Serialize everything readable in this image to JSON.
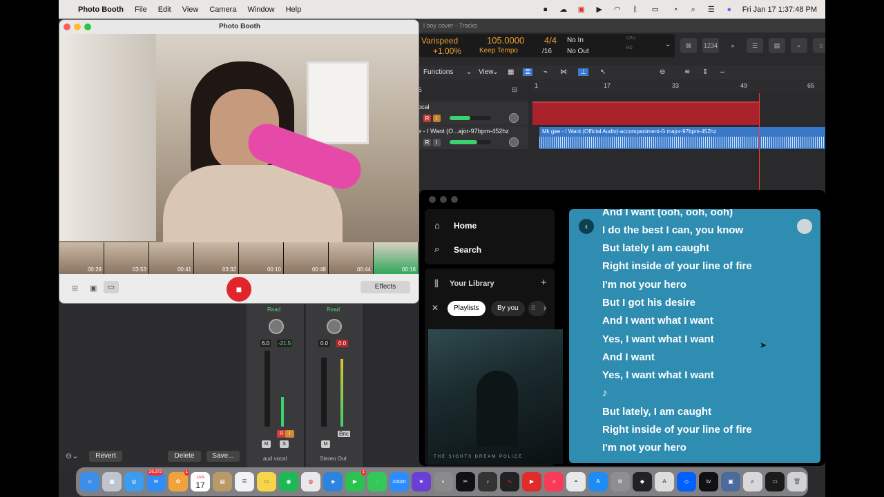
{
  "menubar": {
    "app_name": "Photo Booth",
    "items": [
      "File",
      "Edit",
      "View",
      "Camera",
      "Window",
      "Help"
    ],
    "clock": "Fri Jan 17  1:37:48 PM"
  },
  "logic": {
    "window_title": "l boy cover - Tracks",
    "lcd": {
      "varispeed_label": "Varispeed",
      "varispeed_value": "+1.00%",
      "tempo": "105.0000",
      "tempo_mode": "Keep Tempo",
      "signature_top": "4/4",
      "signature_bottom": "/16",
      "in_label": "No In",
      "out_label": "No Out",
      "cpu_label": "CPU",
      "hd_label": "HD"
    },
    "counter": "1234",
    "menu": {
      "functions": "Functions",
      "view": "View"
    },
    "ruler": [
      "1",
      "17",
      "33",
      "49",
      "65"
    ],
    "tracks": [
      {
        "name": "ocal",
        "r": "R",
        "i": "I"
      },
      {
        "name": "e - I Want (O...ajor-97bpm-452hz",
        "r": "R",
        "i": "I"
      }
    ],
    "region_label": "Mk gee - I Want (Official Audio)-accompaniment-G major-97bpm-452hz",
    "side_label": "S"
  },
  "mixer": {
    "strips": [
      {
        "automation": "Read",
        "values": [
          "6.0",
          "-21.5"
        ],
        "name": "aud vocal",
        "m": "M",
        "s": "S",
        "r": "R",
        "i": "I"
      },
      {
        "automation": "Read",
        "values": [
          "0.0",
          "0.0"
        ],
        "name": "Stereo Out",
        "m": "M",
        "bnc": "Bnc"
      }
    ]
  },
  "photobooth": {
    "title": "Photo Booth",
    "thumbnails": [
      "00:29",
      "03:53",
      "00:41",
      "03:32",
      "00:10",
      "00:48",
      "00:44",
      "00:16"
    ],
    "effects": "Effects",
    "revert": "Revert",
    "delete": "Delete",
    "save": "Save..."
  },
  "spotify": {
    "nav": {
      "home": "Home",
      "search": "Search"
    },
    "library": "Your Library",
    "filters": [
      "Playlists",
      "By you",
      "B"
    ],
    "album_text": "THE SIGHTS   DREAM POLICE",
    "lyrics": [
      "And I want (ooh, ooh, ooh)",
      "I do the best I can, you know",
      "But lately I am caught",
      "Right inside of your line of fire",
      "I'm not your hero",
      "But I got his desire",
      "And I want what I want",
      "Yes, I want what I want",
      "And I want",
      "Yes, I want what I want",
      "♪",
      "But lately, I am caught",
      "Right inside of your line of fire",
      "I'm not your hero"
    ]
  },
  "dock": {
    "badges": {
      "mail": "26,372",
      "photos_badge": "1",
      "facetime_badge": "1"
    },
    "calendar": {
      "month": "JAN",
      "day": "17"
    },
    "apps": [
      "finder-icon",
      "launchpad-icon",
      "safari-icon",
      "mail-icon",
      "photos-icon",
      "calendar-icon",
      "notes-icon",
      "reminders-icon",
      "spotify-icon",
      "chrome-icon",
      "safari2-icon",
      "facetime-icon",
      "messages-icon",
      "zoom-icon",
      "imovie-icon",
      "gamecenter-icon",
      "capcut-icon",
      "garageband-icon",
      "voicememos-icon",
      "youtube-icon",
      "music-icon",
      "settings-icon",
      "appstore-icon",
      "resolve-icon",
      "fontbook-icon",
      "dropbox-icon",
      "appletv-icon",
      "preview-icon",
      "logic-icon",
      "terminal-icon",
      "trash-icon"
    ],
    "zoom_label": "zoom",
    "tv_label": "tv"
  }
}
